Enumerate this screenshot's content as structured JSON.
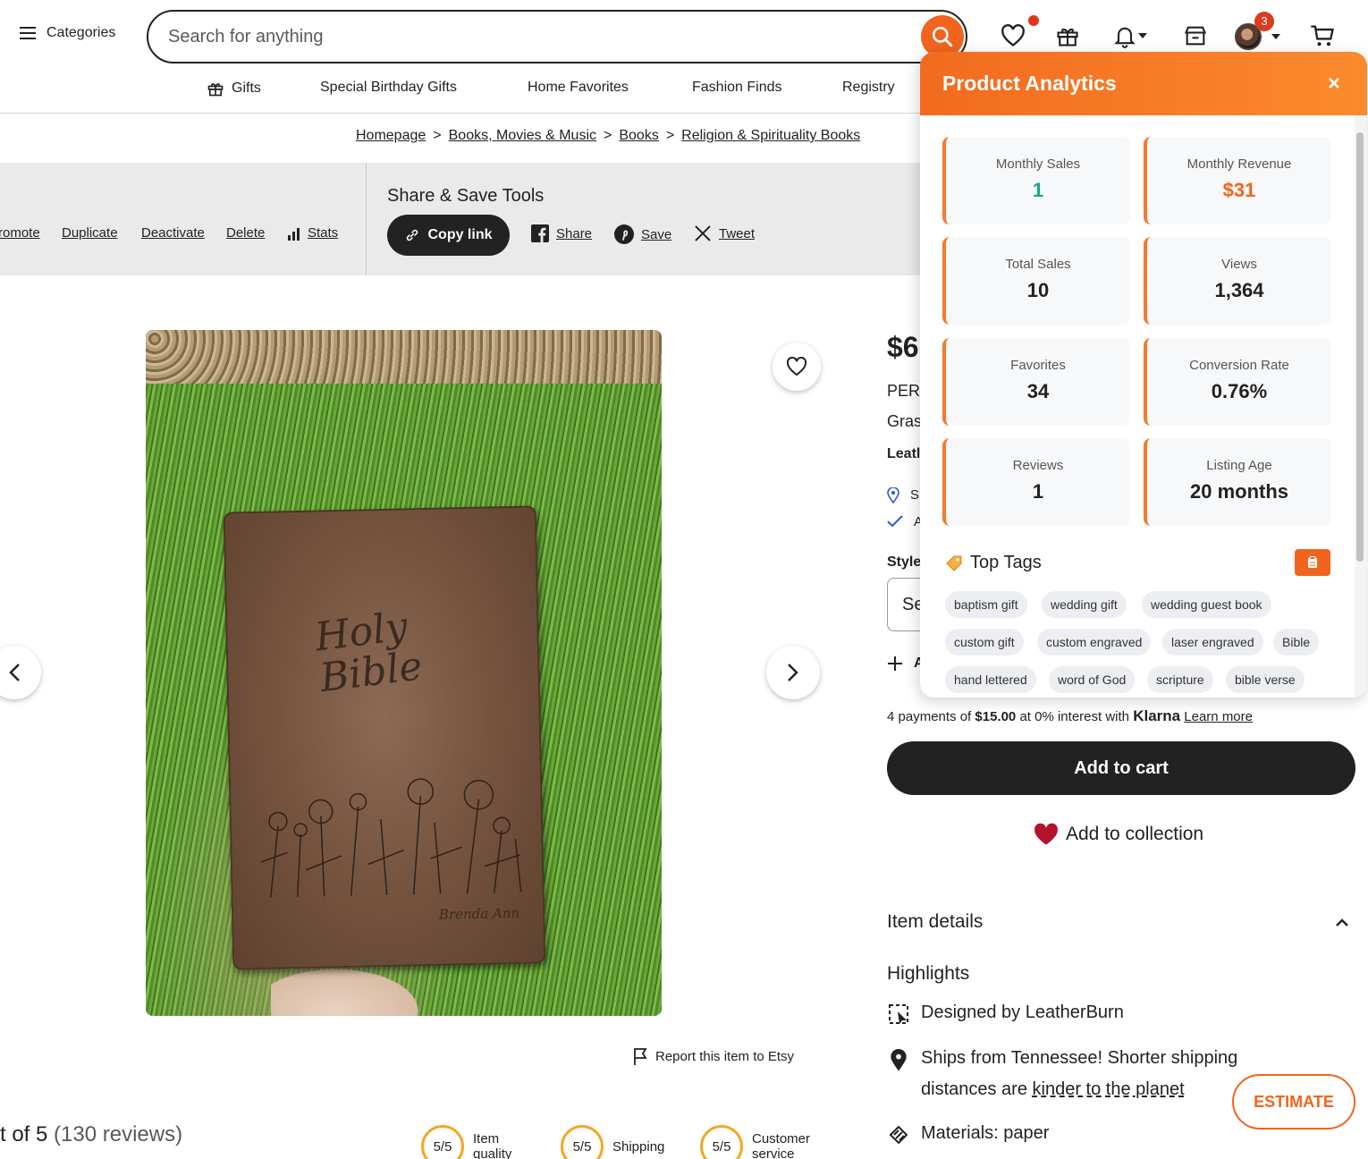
{
  "header": {
    "categories_label": "Categories",
    "search_placeholder": "Search for anything",
    "notification_count": "3"
  },
  "nav": [
    "Gifts",
    "Special Birthday Gifts",
    "Home Favorites",
    "Fashion Finds",
    "Registry"
  ],
  "breadcrumb": [
    "Homepage",
    "Books, Movies & Music",
    "Books",
    "Religion & Spirituality Books"
  ],
  "tools": {
    "links": [
      "romote",
      "Duplicate",
      "Deactivate",
      "Delete",
      "Stats"
    ],
    "title": "Share & Save Tools",
    "copy_link": "Copy link",
    "share": "Share",
    "save": "Save",
    "tweet": "Tweet"
  },
  "image": {
    "title_text": "Holy\nBible",
    "name_text": "Brenda Ann"
  },
  "report": "Report this item to Etsy",
  "reviews": {
    "rating_prefix": "t of 5",
    "count": "(130 reviews)",
    "scores": [
      {
        "value": "5/5",
        "label": "Item quality"
      },
      {
        "value": "5/5",
        "label": "Shipping"
      },
      {
        "value": "5/5",
        "label": "Customer service"
      }
    ]
  },
  "product": {
    "price": "$6",
    "title_line1": "PER",
    "title_line2": "Gras",
    "shop": "Leatl",
    "loc_fragment": "S",
    "check_fragment": "A",
    "style_label": "Style",
    "style_value": "Se",
    "add_fragment": "A",
    "klarna_prefix": "4 payments of",
    "klarna_amount": "$15.00",
    "klarna_mid": "at 0% interest with",
    "klarna_brand": "Klarna",
    "klarna_link": "Learn more",
    "add_to_cart": "Add to cart",
    "add_to_collection": "Add to collection",
    "item_details": "Item details",
    "highlights": "Highlights",
    "designed_prefix": "Designed by",
    "designed_by": "LeatherBurn",
    "ships_line1": "Ships from Tennessee! Shorter shipping",
    "ships_line2_prefix": "distances are",
    "ships_link": "kinder to the planet",
    "materials": "Materials: paper",
    "estimate": "ESTIMATE"
  },
  "analytics": {
    "title": "Product Analytics",
    "close": "×",
    "stats": [
      {
        "label": "Monthly Sales",
        "value": "1",
        "color": "#1aa689"
      },
      {
        "label": "Monthly Revenue",
        "value": "$31",
        "color": "#f1641e"
      },
      {
        "label": "Total Sales",
        "value": "10",
        "color": "#222222"
      },
      {
        "label": "Views",
        "value": "1,364",
        "color": "#222222"
      },
      {
        "label": "Favorites",
        "value": "34",
        "color": "#222222"
      },
      {
        "label": "Conversion Rate",
        "value": "0.76%",
        "color": "#222222"
      },
      {
        "label": "Reviews",
        "value": "1",
        "color": "#222222"
      },
      {
        "label": "Listing Age",
        "value": "20 months",
        "color": "#222222"
      }
    ],
    "tags_title": "Top Tags",
    "tags": [
      "baptism gift",
      "wedding gift",
      "wedding guest book",
      "custom gift",
      "custom engraved",
      "laser engraved",
      "Bible",
      "hand lettered",
      "word of God",
      "scripture",
      "bible verse"
    ]
  },
  "colors": {
    "accent": "#f1641e",
    "dark": "#222222"
  }
}
